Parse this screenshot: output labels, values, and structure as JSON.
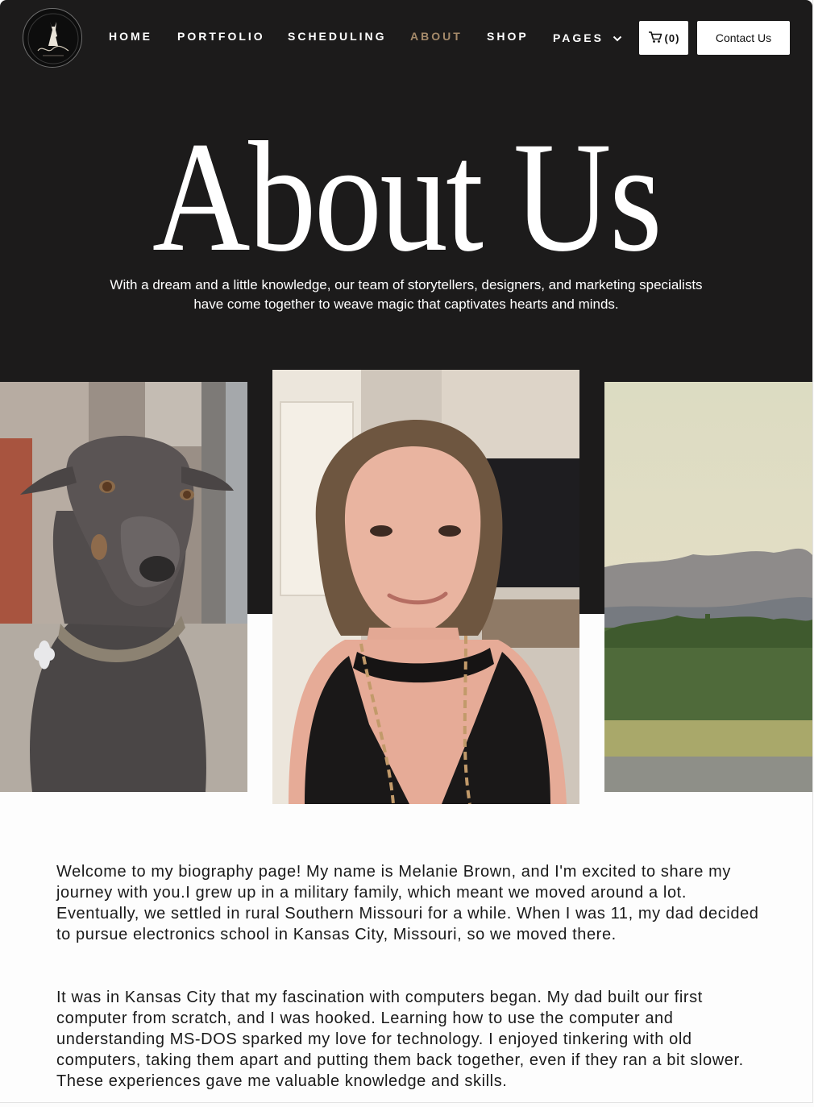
{
  "header": {
    "logo_icon": "brand-logo",
    "nav": [
      {
        "label": "HOME",
        "active": false
      },
      {
        "label": "PORTFOLIO",
        "active": false
      },
      {
        "label": "SCHEDULING",
        "active": false
      },
      {
        "label": "ABOUT",
        "active": true
      },
      {
        "label": "SHOP",
        "active": false
      },
      {
        "label": "PAGES",
        "active": false,
        "has_dropdown": true
      }
    ],
    "cart": {
      "icon": "cart-icon",
      "count_label": "(0)"
    },
    "contact_label": "Contact Us"
  },
  "hero": {
    "title": "About Us",
    "subtitle": "With a dream and a little knowledge, our team of storytellers, designers, and marketing specialists have come together to weave magic that captivates hearts and minds."
  },
  "gallery": [
    {
      "subject": "dog-photo"
    },
    {
      "subject": "portrait-photo"
    },
    {
      "subject": "landscape-photo"
    }
  ],
  "bio": {
    "paragraphs": [
      "Welcome to my biography page! My name is Melanie Brown, and I'm excited to share my journey with you.I grew up in a military family, which meant we moved around a lot. Eventually, we settled in rural Southern Missouri for a while. When I was 11, my dad decided to pursue electronics school in Kansas City, Missouri, so we moved there.",
      "It was in Kansas City that my fascination with computers began. My dad built our first computer from scratch, and I was hooked. Learning how to use the computer and understanding MS-DOS sparked my love for technology. I enjoyed tinkering with old computers, taking them apart and putting them back together, even if they ran a bit slower. These experiences gave me valuable knowledge and skills."
    ]
  },
  "colors": {
    "hero_background": "#1c1b1b",
    "active_nav": "#a58a6a",
    "text_light": "#ffffff",
    "text_dark": "#1a1a1a"
  }
}
